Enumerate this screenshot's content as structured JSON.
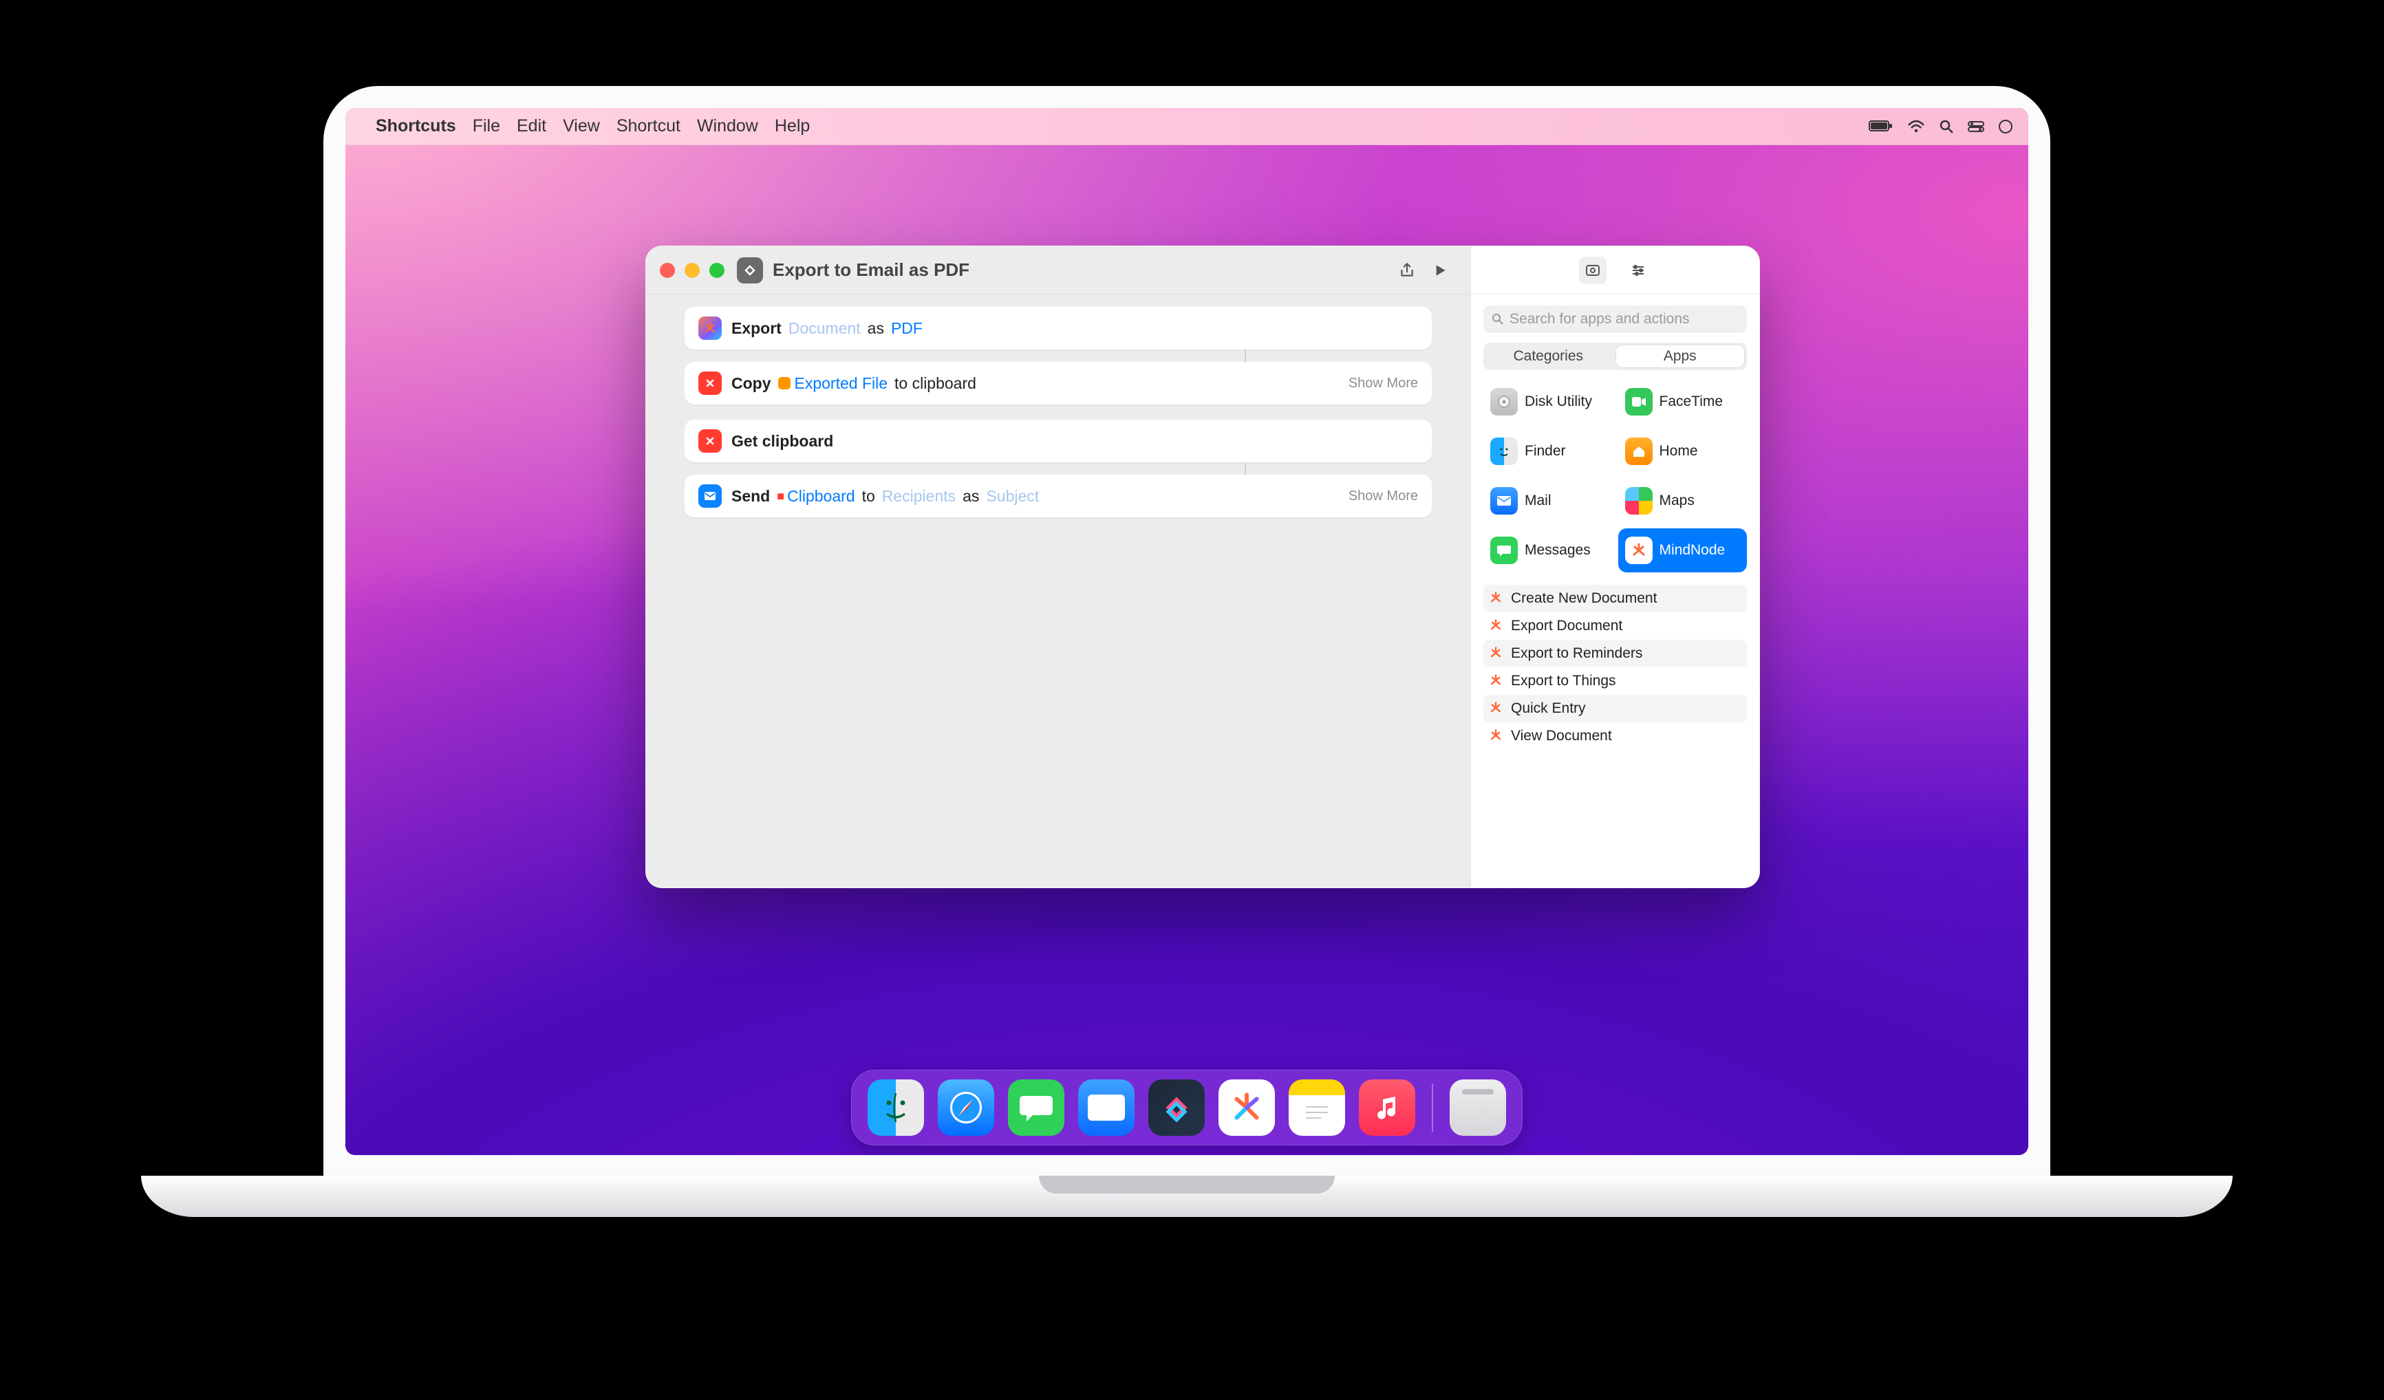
{
  "menubar": {
    "app": "Shortcuts",
    "items": [
      "File",
      "Edit",
      "View",
      "Shortcut",
      "Window",
      "Help"
    ]
  },
  "window": {
    "title": "Export to Email as PDF",
    "steps": [
      {
        "icon": "mindnode",
        "verb": "Export",
        "tokens": [
          {
            "t": "ghost",
            "v": "Document"
          },
          {
            "t": "word",
            "v": "as"
          },
          {
            "t": "link",
            "v": "PDF"
          }
        ],
        "show_more": false
      },
      {
        "icon": "red",
        "verb": "Copy",
        "tokens": [
          {
            "t": "pill-orange",
            "v": "Exported File"
          },
          {
            "t": "word",
            "v": "to clipboard"
          }
        ],
        "show_more": true,
        "show_more_label": "Show More"
      },
      {
        "icon": "red",
        "verb": "Get clipboard",
        "tokens": [],
        "show_more": false
      },
      {
        "icon": "blue",
        "verb": "Send",
        "tokens": [
          {
            "t": "pill-red",
            "v": "Clipboard"
          },
          {
            "t": "word",
            "v": "to"
          },
          {
            "t": "ghost",
            "v": "Recipients"
          },
          {
            "t": "word",
            "v": "as"
          },
          {
            "t": "ghost",
            "v": "Subject"
          }
        ],
        "show_more": true,
        "show_more_label": "Show More"
      }
    ]
  },
  "sidebar": {
    "search_placeholder": "Search for apps and actions",
    "seg": {
      "left": "Categories",
      "right": "Apps",
      "active": "Apps"
    },
    "apps": [
      {
        "name": "Disk Utility",
        "cls": "diskutil"
      },
      {
        "name": "FaceTime",
        "cls": "facetime"
      },
      {
        "name": "Finder",
        "cls": "finder"
      },
      {
        "name": "Home",
        "cls": "home"
      },
      {
        "name": "Mail",
        "cls": "mail"
      },
      {
        "name": "Maps",
        "cls": "maps"
      },
      {
        "name": "Messages",
        "cls": "messages"
      },
      {
        "name": "MindNode",
        "cls": "mindnode",
        "selected": true
      }
    ],
    "actions": [
      "Create New Document",
      "Export Document",
      "Export to Reminders",
      "Export to Things",
      "Quick Entry",
      "View Document"
    ]
  },
  "dock": [
    {
      "name": "Finder",
      "cls": "finder"
    },
    {
      "name": "Safari",
      "cls": "safari"
    },
    {
      "name": "Messages",
      "cls": "messages"
    },
    {
      "name": "Mail",
      "cls": "mail"
    },
    {
      "name": "Shortcuts",
      "cls": "shortcuts"
    },
    {
      "name": "MindNode",
      "cls": "mindnode"
    },
    {
      "name": "Notes",
      "cls": "notes"
    },
    {
      "name": "Music",
      "cls": "music"
    },
    {
      "sep": true
    },
    {
      "name": "Trash",
      "cls": "trash"
    }
  ]
}
